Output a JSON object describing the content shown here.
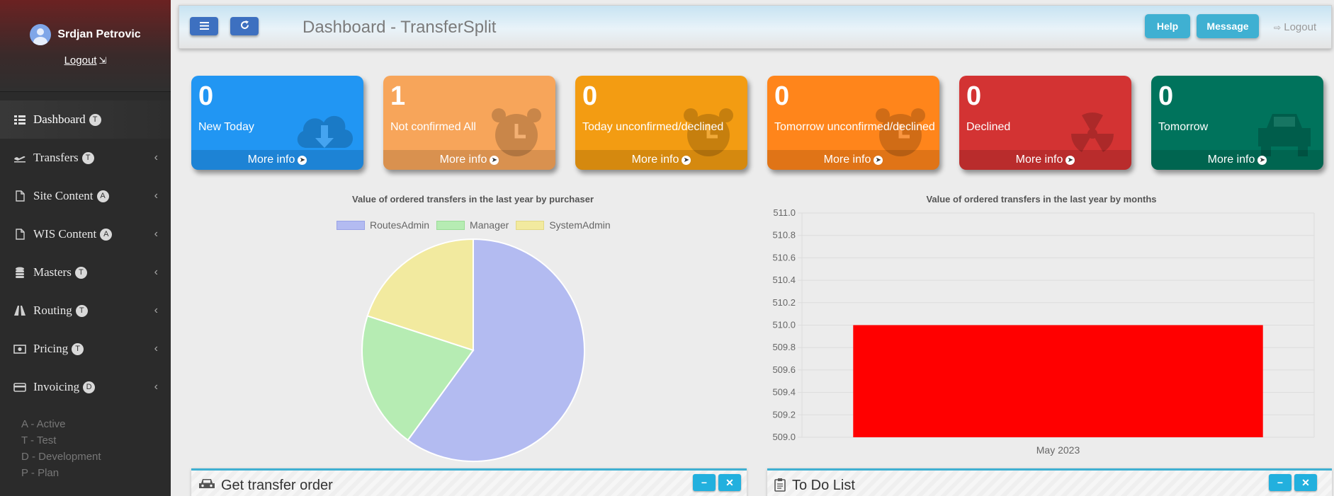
{
  "sidebar": {
    "user_name": "Srdjan Petrovic",
    "logout_label": "Logout",
    "items": [
      {
        "label": "Dashboard",
        "badge": "T",
        "icon": "grid-icon"
      },
      {
        "label": "Transfers",
        "badge": "T",
        "icon": "plane-icon"
      },
      {
        "label": "Site Content",
        "badge": "A",
        "icon": "file-icon"
      },
      {
        "label": "WIS Content",
        "badge": "A",
        "icon": "file-icon"
      },
      {
        "label": "Masters",
        "badge": "T",
        "icon": "database-icon"
      },
      {
        "label": "Routing",
        "badge": "T",
        "icon": "road-icon"
      },
      {
        "label": "Pricing",
        "badge": "T",
        "icon": "money-icon"
      },
      {
        "label": "Invoicing",
        "badge": "D",
        "icon": "credit-card-icon"
      }
    ],
    "legend": [
      "A - Active",
      "T - Test",
      "D - Development",
      "P - Plan"
    ]
  },
  "header": {
    "title": "Dashboard - TransferSplit",
    "help_label": "Help",
    "message_label": "Message",
    "logout_label": "Logout"
  },
  "boxes": [
    {
      "value": "0",
      "label": "New Today",
      "more": "More info",
      "color": "#2196f3",
      "icon": "cloud-download-icon"
    },
    {
      "value": "1",
      "label": "Not confirmed All",
      "more": "More info",
      "color": "#f7a55a",
      "icon": "alarm-clock-icon"
    },
    {
      "value": "0",
      "label": "Today unconfirmed/declined",
      "more": "More info",
      "color": "#f39c12",
      "icon": "alarm-clock-icon"
    },
    {
      "value": "0",
      "label": "Tomorrow unconfirmed/declined",
      "more": "More info",
      "color": "#ff851b",
      "icon": "alarm-clock-icon"
    },
    {
      "value": "0",
      "label": "Declined",
      "more": "More info",
      "color": "#d33333",
      "icon": "radiation-icon"
    },
    {
      "value": "0",
      "label": "Tomorrow",
      "more": "More info",
      "color": "#00735c",
      "icon": "car-icon"
    }
  ],
  "chart_data": [
    {
      "type": "pie",
      "title": "Value of ordered transfers in the last year by purchaser",
      "labels": [
        "RoutesAdmin",
        "Manager",
        "SystemAdmin"
      ],
      "values": [
        60,
        20,
        20
      ],
      "colors": [
        "#b3bbf1",
        "#b6ecb3",
        "#f2ea9f"
      ],
      "legend": "top"
    },
    {
      "type": "bar",
      "title": "Value of ordered transfers in the last year by months",
      "categories": [
        "May 2023"
      ],
      "values": [
        510.0
      ],
      "ylim": [
        509.0,
        511.0
      ],
      "yticks": [
        "511.0",
        "510.8",
        "510.6",
        "510.4",
        "510.2",
        "510.0",
        "509.8",
        "509.6",
        "509.4",
        "509.2",
        "509.0"
      ],
      "color": "#ff0000",
      "grid": true
    }
  ],
  "panels": {
    "transfer_order_title": "Get transfer order",
    "todo_title": "To Do List",
    "minimize_label": "−",
    "close_label": "✕"
  }
}
